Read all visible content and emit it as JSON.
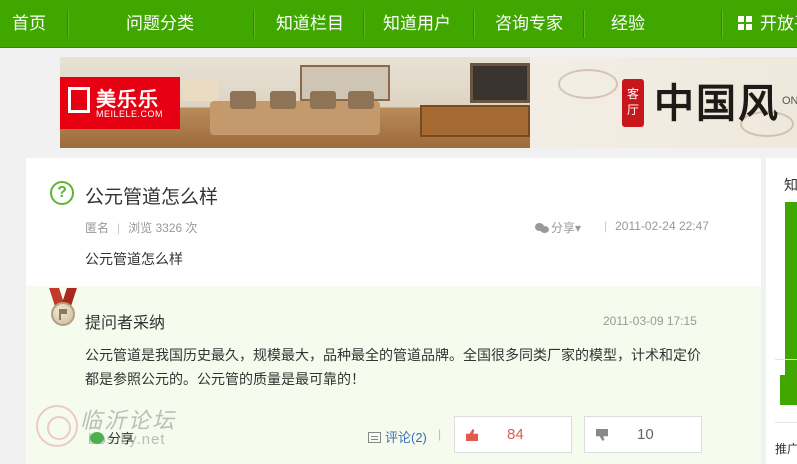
{
  "nav": {
    "items": [
      {
        "label": "首页"
      },
      {
        "label": "问题分类"
      },
      {
        "label": "知道栏目"
      },
      {
        "label": "知道用户"
      },
      {
        "label": "咨询专家"
      },
      {
        "label": "经验"
      },
      {
        "label": "开放平"
      }
    ],
    "color": "#3fa700"
  },
  "banner": {
    "brand_cn": "美乐乐",
    "brand_en": "MEILELE.COM",
    "seal": "客厅",
    "headline": "中国风",
    "edge_text": "ON"
  },
  "question": {
    "title": "公元管道怎么样",
    "author": "匿名",
    "views": "浏览 3326 次",
    "share": "分享",
    "date": "2011-02-24 22:47",
    "description": "公元管道怎么样"
  },
  "answer": {
    "title": "提问者采纳",
    "date": "2011-03-09 17:15",
    "body": "公元管道是我国历史最久，规模最大，品种最全的管道品牌。全国很多同类厂家的模型，计术和定价都是参照公元的。公元管的质量是最可靠的！",
    "share": "分享",
    "comment": "评论(2)",
    "upvotes": "84",
    "downvotes": "10"
  },
  "watermark": {
    "cn": "临沂论坛",
    "en": "bbs.Ly.net"
  },
  "sidebar": {
    "label": "知",
    "footer": "推广"
  }
}
